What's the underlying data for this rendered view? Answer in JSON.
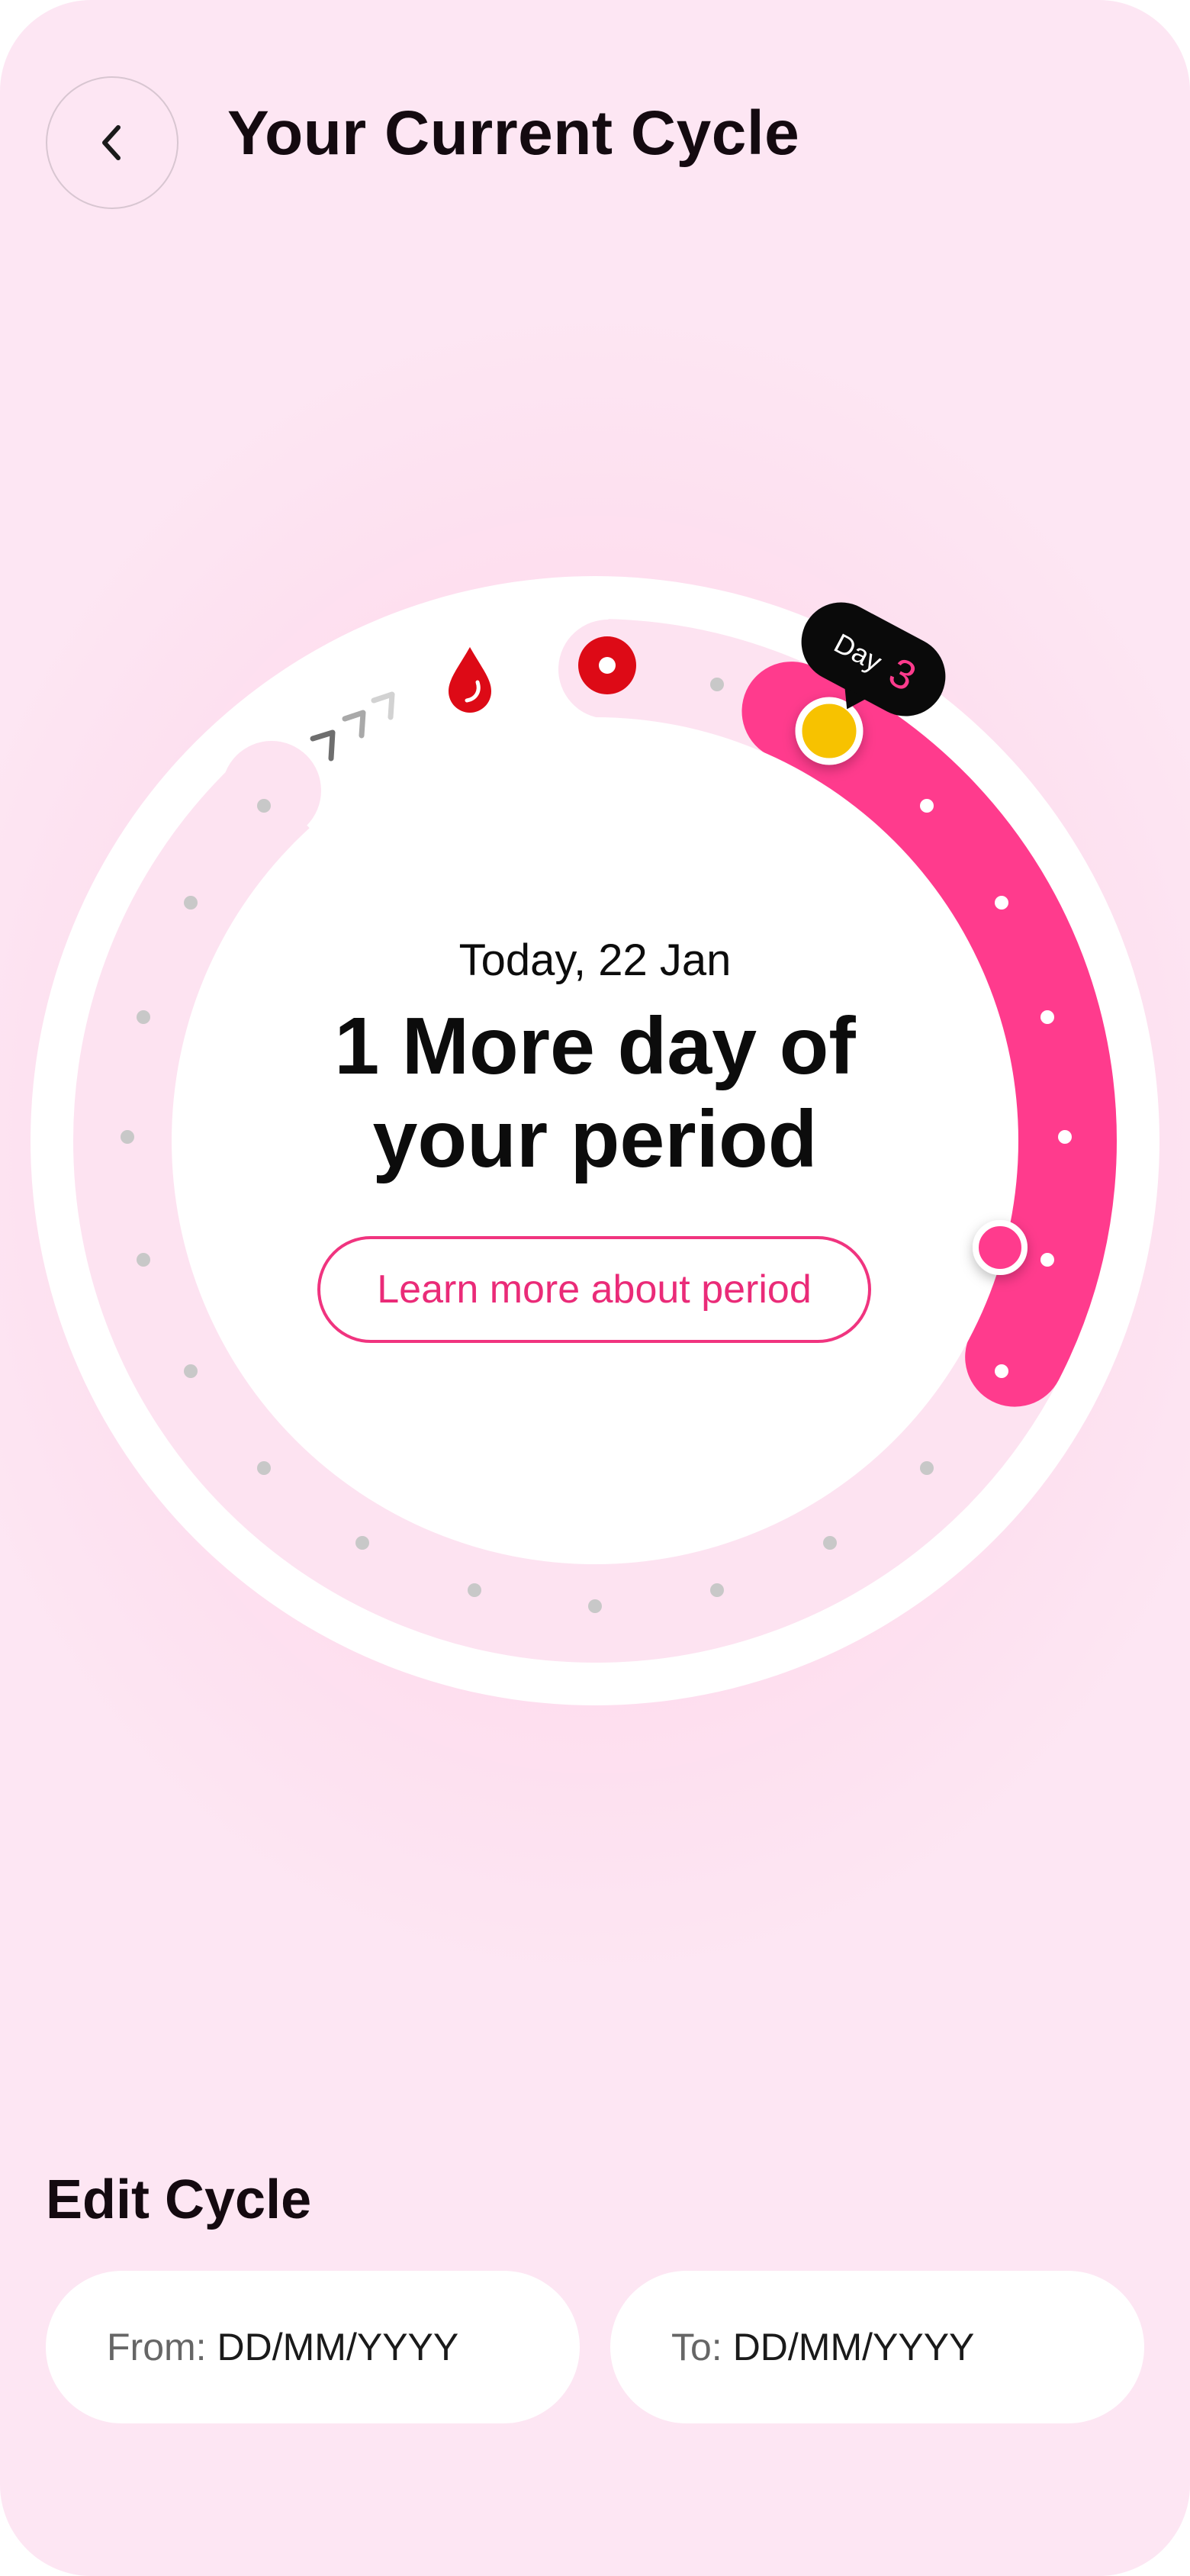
{
  "header": {
    "title": "Your Current Cycle",
    "back_icon": "chevron-left-icon"
  },
  "cycle": {
    "today_label": "Today, 22 Jan",
    "headline_line1": "1 More day of",
    "headline_line2": "your period",
    "learn_more_label": "Learn more about period",
    "tooltip_day_word": "Day",
    "tooltip_day_number": "3",
    "icons": [
      "blood-drop-icon",
      "period-marker-icon",
      "direction-chevrons-icon"
    ]
  },
  "edit_cycle": {
    "title": "Edit Cycle",
    "from_label": "From:",
    "from_placeholder": "DD/MM/YYYY",
    "to_label": "To:",
    "to_placeholder": "DD/MM/YYYY"
  },
  "colors": {
    "accent": "#ff3b8d",
    "accent_text": "#ea2b78",
    "period_red": "#dd0a16",
    "today_marker": "#f7c200",
    "track_light": "#fde3f1",
    "background": "#fde6f3"
  }
}
